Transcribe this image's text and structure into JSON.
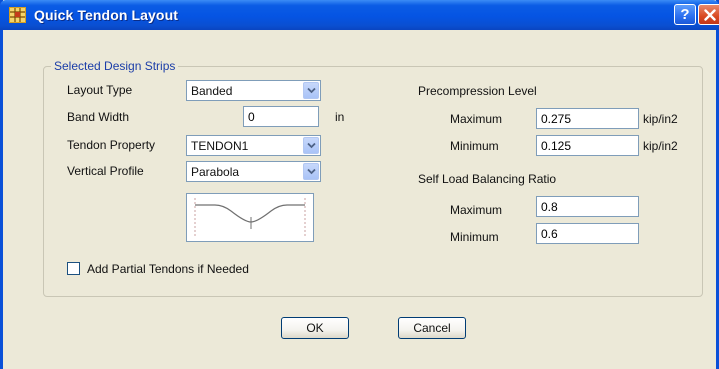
{
  "window": {
    "title": "Quick Tendon Layout",
    "help_label": "?",
    "close_label": "✕",
    "icon": "grid-app-icon"
  },
  "group": {
    "title": "Selected Design Strips"
  },
  "left": {
    "layout_type_label": "Layout Type",
    "layout_type_value": "Banded",
    "band_width_label": "Band Width",
    "band_width_value": "0",
    "band_width_unit": "in",
    "tendon_property_label": "Tendon Property",
    "tendon_property_value": "TENDON1",
    "vertical_profile_label": "Vertical Profile",
    "vertical_profile_value": "Parabola",
    "add_partial_label": "Add Partial Tendons if Needed",
    "add_partial_checked": false
  },
  "right": {
    "precompression_title": "Precompression Level",
    "pc_max_label": "Maximum",
    "pc_max_value": "0.275",
    "pc_max_unit": "kip/in2",
    "pc_min_label": "Minimum",
    "pc_min_value": "0.125",
    "pc_min_unit": "kip/in2",
    "self_load_title": "Self Load Balancing Ratio",
    "sl_max_label": "Maximum",
    "sl_max_value": "0.8",
    "sl_min_label": "Minimum",
    "sl_min_value": "0.6"
  },
  "buttons": {
    "ok": "OK",
    "cancel": "Cancel"
  },
  "colors": {
    "title_bar": "#0554e3",
    "group_title": "#1b3da8",
    "dialog_bg": "#ece9d8"
  }
}
